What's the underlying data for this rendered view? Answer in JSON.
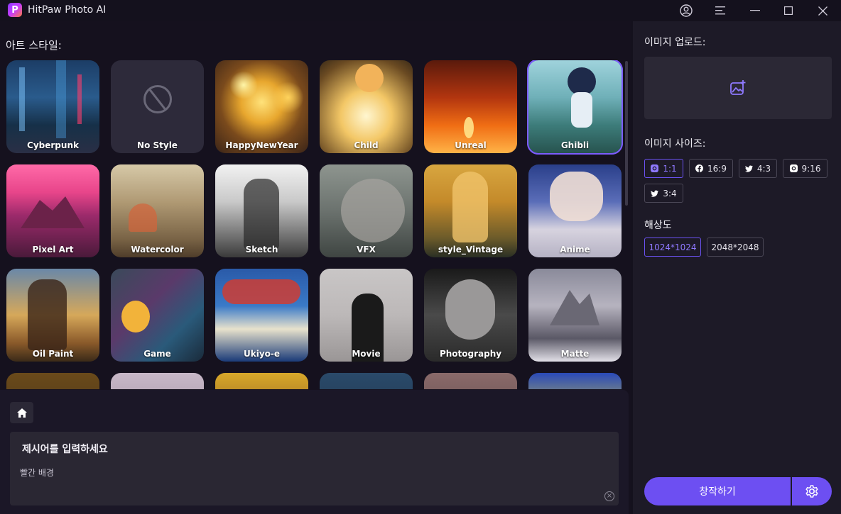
{
  "app": {
    "title": "HitPaw Photo AI",
    "logo_letter": "P"
  },
  "art_styles": {
    "label": "아트 스타일:",
    "rows": [
      [
        {
          "name": "Cyberpunk"
        },
        {
          "name": "No Style"
        },
        {
          "name": "HappyNewYear"
        },
        {
          "name": "Child"
        },
        {
          "name": "Unreal"
        },
        {
          "name": "Ghibli",
          "selected": true
        }
      ],
      [
        {
          "name": "Pixel Art"
        },
        {
          "name": "Watercolor"
        },
        {
          "name": "Sketch"
        },
        {
          "name": "VFX"
        },
        {
          "name": "style_Vintage"
        },
        {
          "name": "Anime"
        }
      ],
      [
        {
          "name": "Oil Paint"
        },
        {
          "name": "Game"
        },
        {
          "name": "Ukiyo-e"
        },
        {
          "name": "Movie"
        },
        {
          "name": "Photography"
        },
        {
          "name": "Matte"
        }
      ]
    ]
  },
  "prompt": {
    "title": "제시어를 입력하세요",
    "value": "빨간 배경"
  },
  "upload": {
    "label": "이미지 업로드:"
  },
  "size": {
    "label": "이미지 사이즈:",
    "options": [
      {
        "label": "1:1",
        "icon": "instagram-icon",
        "active": true
      },
      {
        "label": "16:9",
        "icon": "facebook-icon"
      },
      {
        "label": "4:3",
        "icon": "twitter-icon"
      },
      {
        "label": "9:16",
        "icon": "instagram-icon"
      },
      {
        "label": "3:4",
        "icon": "twitter-icon"
      }
    ]
  },
  "resolution": {
    "label": "해상도",
    "options": [
      {
        "label": "1024*1024",
        "active": true
      },
      {
        "label": "2048*2048"
      }
    ]
  },
  "actions": {
    "create_label": "창작하기"
  },
  "colors": {
    "accent": "#6d4ff2",
    "accent_text": "#8f79ff",
    "background": "#14111d"
  }
}
